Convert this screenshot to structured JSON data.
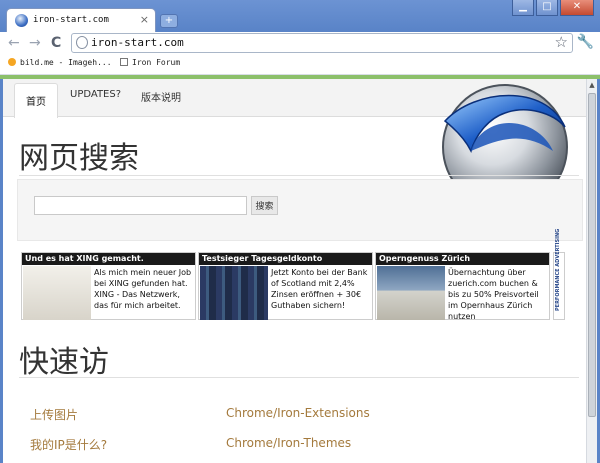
{
  "browser": {
    "tab_title": "iron-start.com",
    "tab_close": "×",
    "new_tab": "+",
    "window_buttons": {
      "minimize": "▁",
      "maximize": "□",
      "close": "✕"
    },
    "nav": {
      "back": "←",
      "forward": "→",
      "reload": "C"
    },
    "url": "iron-start.com",
    "star": "☆",
    "menu": "🔧",
    "bookmarks": [
      {
        "label": "bild.me - Imageh..."
      },
      {
        "label": "Iron Forum"
      }
    ]
  },
  "page": {
    "tabs": [
      {
        "label": "首页"
      },
      {
        "label": "UPDATES?"
      },
      {
        "label": "版本说明"
      }
    ],
    "search_heading": "网页搜索",
    "search_input_value": "",
    "search_button": "搜索",
    "ads": [
      {
        "title": "Und es hat XING gemacht.",
        "text": "Als mich mein neuer Job bei XING gefunden hat. XING - Das Netzwerk, das für mich arbeitet."
      },
      {
        "title": "Testsieger Tagesgeldkonto",
        "text": "Jetzt Konto bei der Bank of Scotland mit 2,4% Zinsen eröffnen + 30€ Guthaben sichern!"
      },
      {
        "title": "Operngenuss Zürich",
        "text": "Übernachtung über zuerich.com buchen & bis zu 50% Preisvorteil im Opernhaus Zürich nutzen"
      }
    ],
    "ad_badge": "PERFORMANCE ADVERTISING",
    "quick_heading": "快速访",
    "quick_links_left": [
      {
        "label": "上传图片"
      },
      {
        "label": "我的IP是什么?"
      }
    ],
    "quick_links_right": [
      {
        "label": "Chrome/Iron-Extensions"
      },
      {
        "label": "Chrome/Iron-Themes"
      }
    ]
  },
  "colors": {
    "frame": "#5a84c8",
    "accent_green": "#8cc06a",
    "link": "#a47a3d",
    "logo_blue": "#1f5fc8"
  },
  "icons": [
    "iron-favicon-icon",
    "close-icon",
    "plus-icon",
    "back-icon",
    "forward-icon",
    "reload-icon",
    "page-icon",
    "star-icon",
    "wrench-icon",
    "bookmark-icon",
    "folder-icon",
    "iron-logo-icon"
  ]
}
